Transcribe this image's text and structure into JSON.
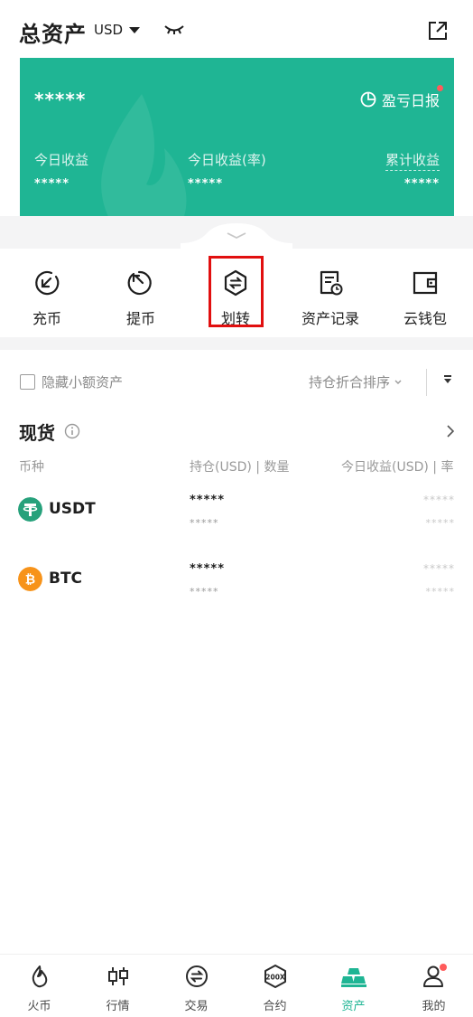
{
  "header": {
    "title": "总资产",
    "currency": "USD"
  },
  "card": {
    "total_masked": "*****",
    "report_label": "盈亏日报",
    "stats": [
      {
        "label": "今日收益",
        "value": "*****"
      },
      {
        "label": "今日收益(率)",
        "value": "*****"
      },
      {
        "label": "累计收益",
        "value": "*****"
      }
    ]
  },
  "actions": [
    {
      "label": "充币",
      "icon": "deposit-icon"
    },
    {
      "label": "提币",
      "icon": "withdraw-icon"
    },
    {
      "label": "划转",
      "icon": "transfer-icon"
    },
    {
      "label": "资产记录",
      "icon": "records-icon"
    },
    {
      "label": "云钱包",
      "icon": "wallet-icon"
    }
  ],
  "filter": {
    "hide_small": "隐藏小额资产",
    "sort_label": "持仓折合排序"
  },
  "spot": {
    "title": "现货",
    "columns": [
      "币种",
      "持仓(USD) | 数量",
      "今日收益(USD) | 率"
    ],
    "rows": [
      {
        "name": "USDT",
        "hold_usd": "*****",
        "hold_qty": "*****",
        "pnl": "*****",
        "pnl_rate": "*****"
      },
      {
        "name": "BTC",
        "hold_usd": "*****",
        "hold_qty": "*****",
        "pnl": "*****",
        "pnl_rate": "*****"
      }
    ]
  },
  "nav": [
    {
      "label": "火币",
      "icon": "flame-icon"
    },
    {
      "label": "行情",
      "icon": "candlestick-icon"
    },
    {
      "label": "交易",
      "icon": "exchange-icon"
    },
    {
      "label": "合约",
      "icon": "contract-icon"
    },
    {
      "label": "资产",
      "icon": "assets-icon",
      "active": true
    },
    {
      "label": "我的",
      "icon": "profile-icon"
    }
  ],
  "colors": {
    "accent": "#1fb594",
    "highlight_border": "#e10f0f",
    "usdt": "#26a17b",
    "btc": "#f7931a"
  }
}
